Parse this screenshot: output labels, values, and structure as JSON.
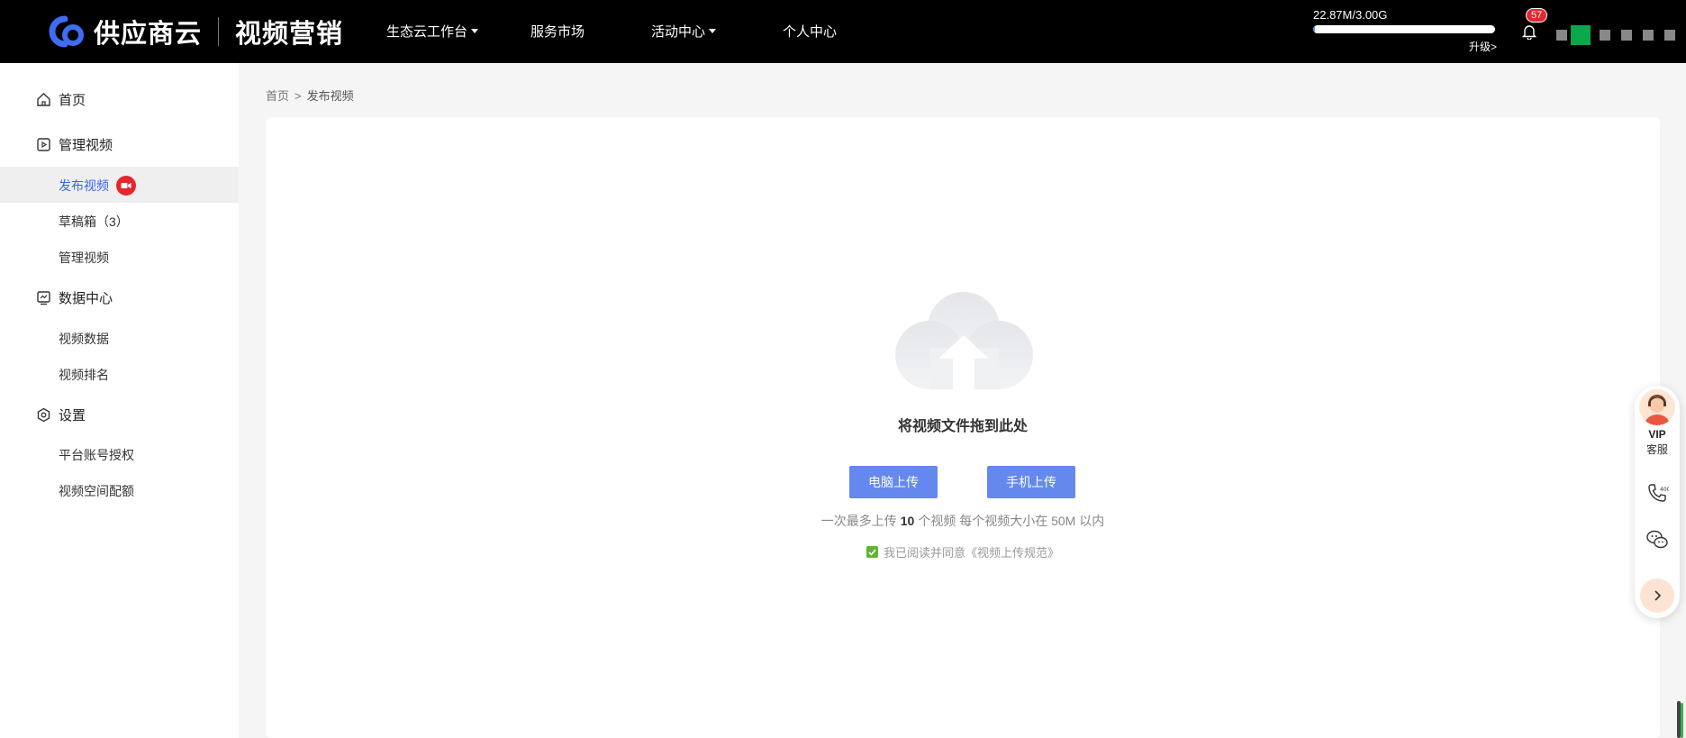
{
  "header": {
    "brand": "供应商云",
    "product": "视频营销",
    "nav": [
      {
        "label": "生态云工作台",
        "dropdown": true
      },
      {
        "label": "服务市场",
        "dropdown": false
      },
      {
        "label": "活动中心",
        "dropdown": true
      },
      {
        "label": "个人中心",
        "dropdown": false
      }
    ],
    "storage": {
      "text": "22.87M/3.00G",
      "used_fraction": 0.0074,
      "upgrade_label": "升级>"
    },
    "notification_count": "57"
  },
  "sidebar": {
    "groups": [
      {
        "label": "首页",
        "icon": "home-icon"
      },
      {
        "label": "管理视频",
        "icon": "video-icon",
        "items": [
          "发布视频",
          "草稿箱（3）",
          "管理视频"
        ]
      },
      {
        "label": "数据中心",
        "icon": "chart-icon",
        "items": [
          "视频数据",
          "视频排名"
        ]
      },
      {
        "label": "设置",
        "icon": "settings-icon",
        "items": [
          "平台账号授权",
          "视频空间配额"
        ]
      }
    ],
    "active_item": "发布视频"
  },
  "breadcrumb": {
    "home": "首页",
    "separator": ">",
    "current": "发布视频"
  },
  "upload": {
    "drop_text": "将视频文件拖到此处",
    "pc_button": "电脑上传",
    "mobile_button": "手机上传",
    "limit_prefix": "一次最多上传",
    "limit_count": "10",
    "limit_suffix": "个视频 每个视频大小在 50M 以内",
    "agreement": "我已阅读并同意《视频上传规范》"
  },
  "float_bar": {
    "vip": "VIP",
    "service": "客服"
  },
  "colors": {
    "accent": "#6488ee",
    "active_text": "#3a66e8",
    "badge": "#e4262e",
    "check": "#5fb52f"
  }
}
